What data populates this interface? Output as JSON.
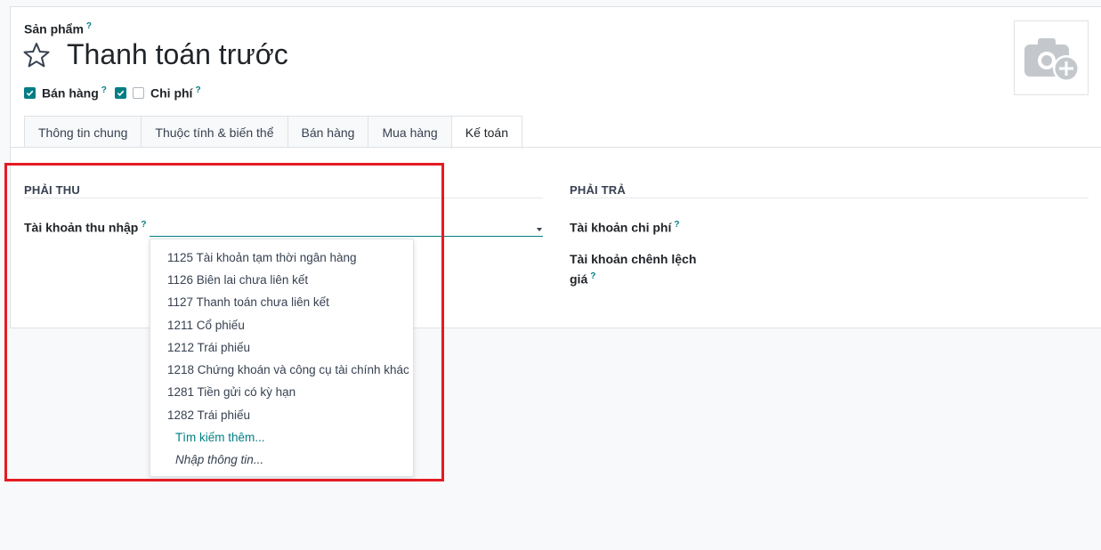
{
  "header": {
    "product_label": "Sản phẩm",
    "help_mark": "?",
    "title": "Thanh toán trước"
  },
  "checkboxes": [
    {
      "label": "Bán hàng",
      "checked": true
    },
    {
      "label": "Chi phí",
      "checked": false
    }
  ],
  "tabs": [
    {
      "label": "Thông tin chung",
      "active": false
    },
    {
      "label": "Thuộc tính & biến thể",
      "active": false
    },
    {
      "label": "Bán hàng",
      "active": false
    },
    {
      "label": "Mua hàng",
      "active": false
    },
    {
      "label": "Kế toán",
      "active": true
    }
  ],
  "receivable": {
    "title": "PHẢI THU",
    "income_account_label": "Tài khoản thu nhập",
    "income_account_value": ""
  },
  "payable": {
    "title": "PHẢI TRẢ",
    "expense_account_label": "Tài khoản chi phí",
    "price_diff_label_line1": "Tài khoản chênh lệch",
    "price_diff_label_line2": "giá"
  },
  "dropdown": {
    "items": [
      "1125 Tài khoản tạm thời ngân hàng",
      "1126 Biên lai chưa liên kết",
      "1127 Thanh toán chưa liên kết",
      "1211 Cổ phiếu",
      "1212 Trái phiếu",
      "1218 Chứng khoán và công cụ tài chính khác",
      "1281 Tiền gửi có kỳ hạn",
      "1282 Trái phiếu"
    ],
    "search_more": "Tìm kiếm thêm...",
    "create_edit": "Nhập thông tin..."
  },
  "colors": {
    "accent": "#017e84",
    "highlight": "#e31b23"
  },
  "icons": {
    "favorite": "star-outline-icon",
    "image_placeholder": "camera-plus-icon"
  }
}
